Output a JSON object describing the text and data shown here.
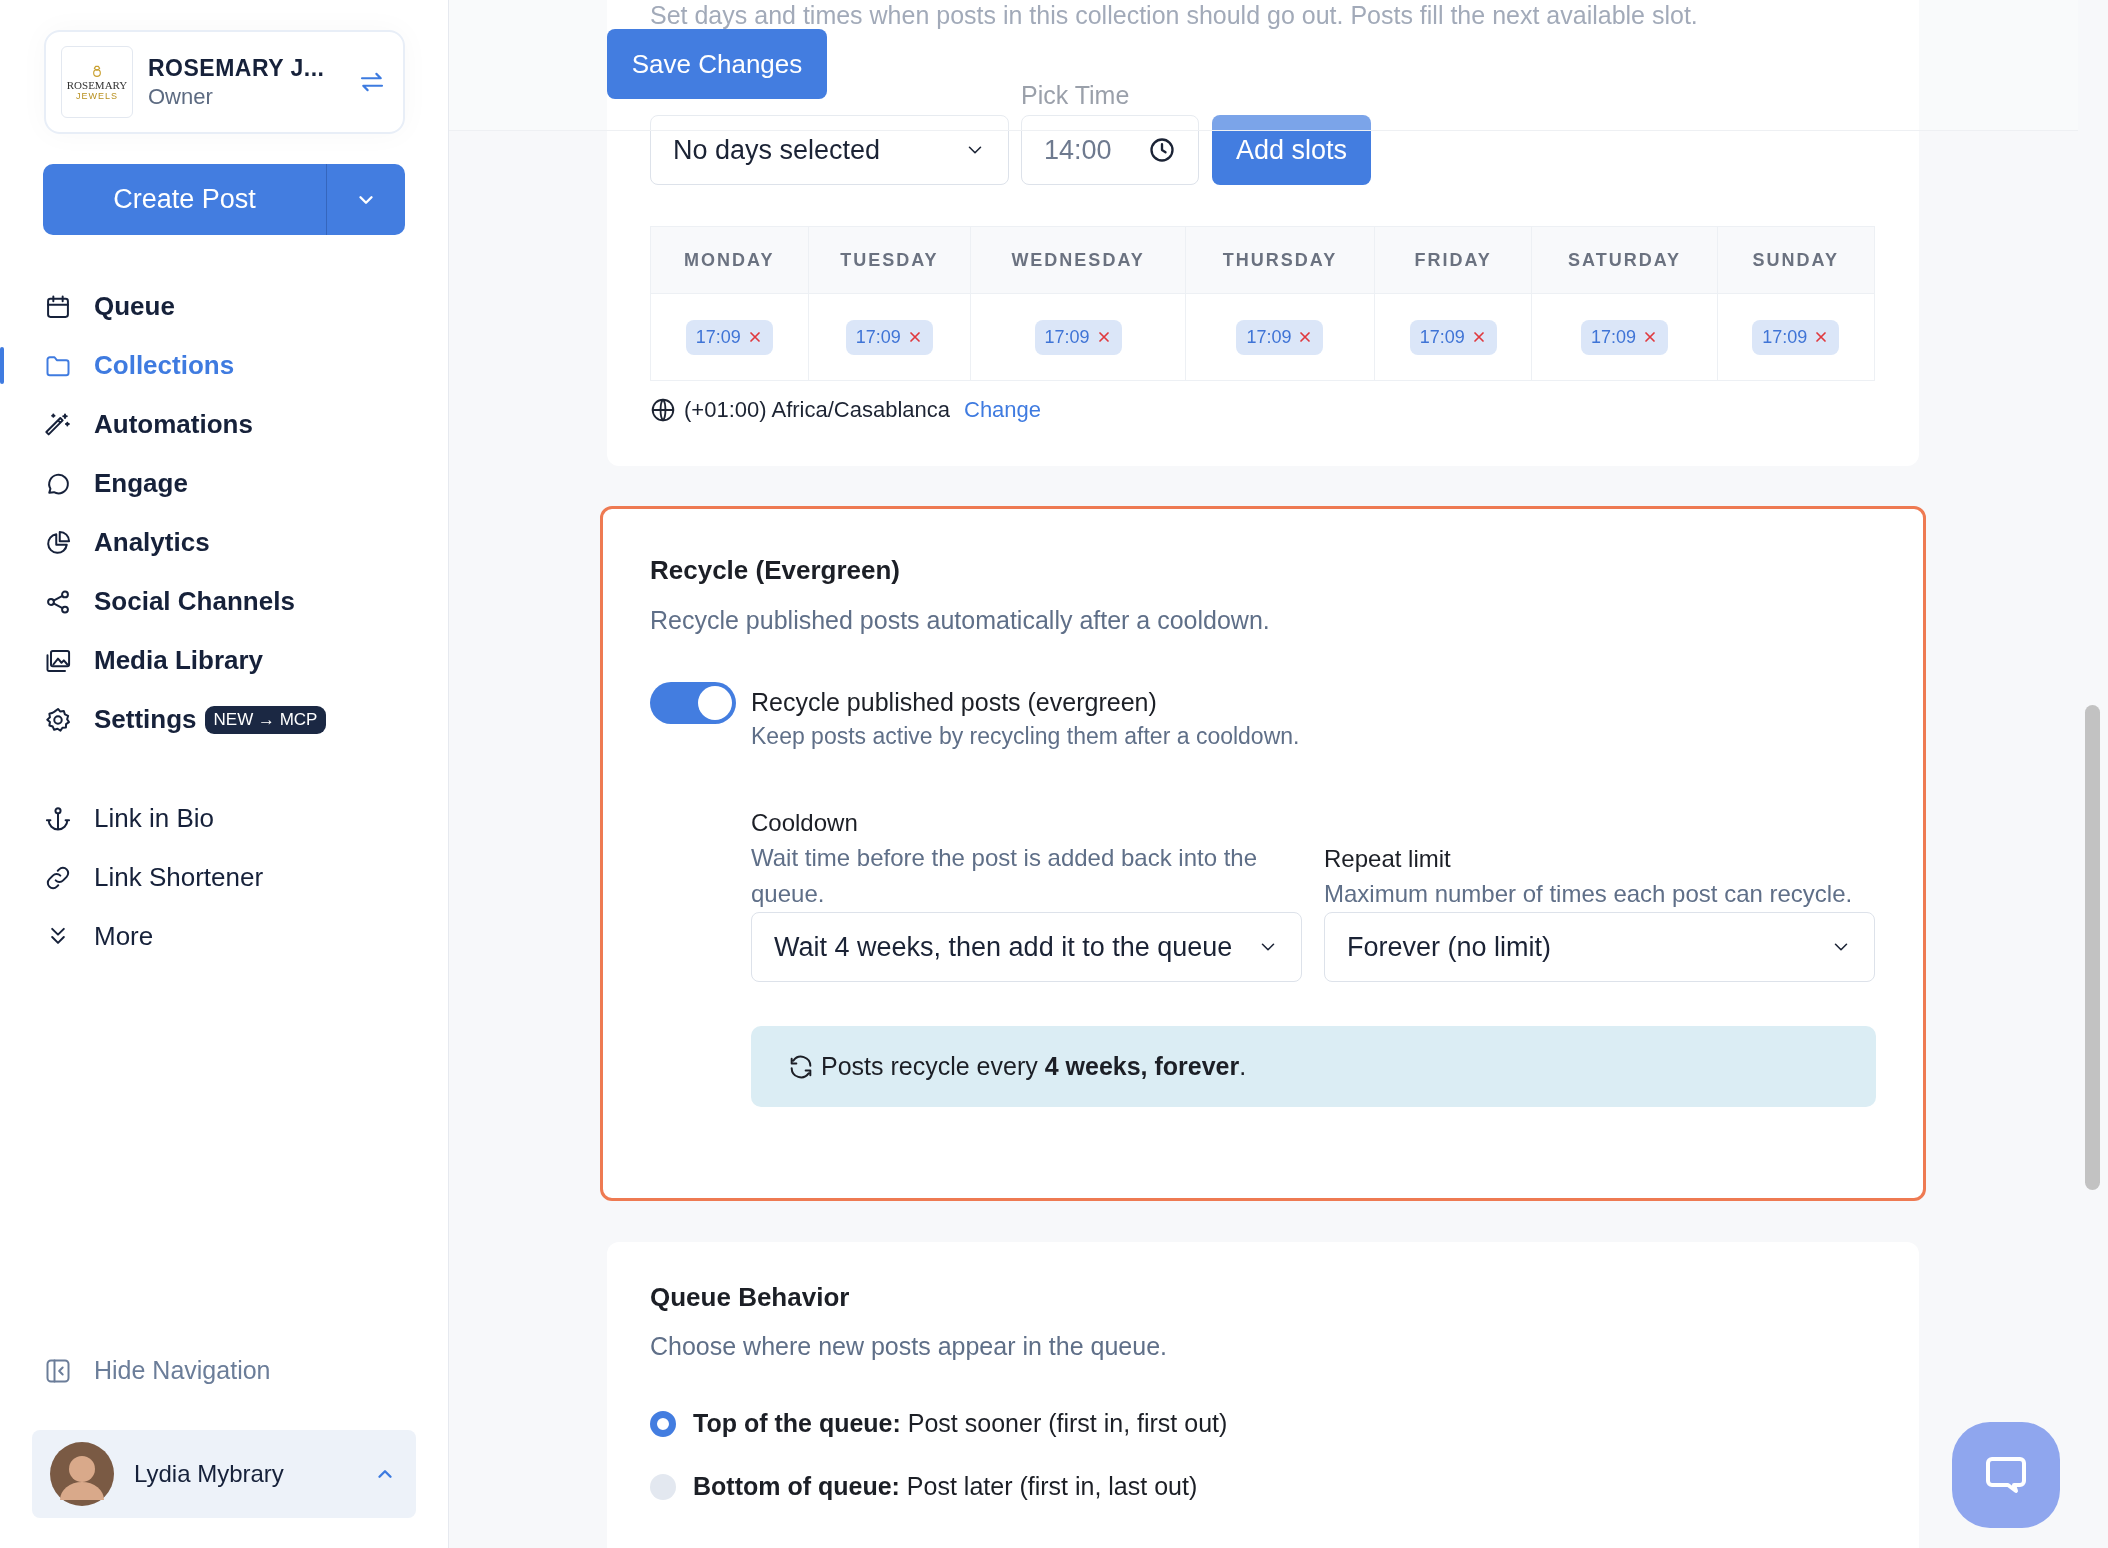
{
  "sidebar": {
    "account": {
      "logo_name": "ROSEMARY",
      "logo_tagline": "JEWELS",
      "name": "ROSEMARY J...",
      "role": "Owner"
    },
    "create_button": "Create Post",
    "primary_nav": [
      {
        "label": "Queue",
        "selected": false
      },
      {
        "label": "Collections",
        "selected": true
      },
      {
        "label": "Automations",
        "selected": false
      },
      {
        "label": "Engage",
        "selected": false
      },
      {
        "label": "Analytics",
        "selected": false
      },
      {
        "label": "Social Channels",
        "selected": false
      },
      {
        "label": "Media Library",
        "selected": false
      },
      {
        "label": "Settings",
        "selected": false,
        "badge": "NEW → MCP"
      }
    ],
    "secondary_nav": [
      {
        "label": "Link in Bio",
        "selected": false
      },
      {
        "label": "Link Shortener",
        "selected": false
      },
      {
        "label": "More",
        "selected": false
      }
    ],
    "hide_navigation": "Hide Navigation",
    "user": {
      "name": "Lydia Mybrary"
    }
  },
  "header": {
    "save_button": "Save Changes"
  },
  "schedule": {
    "description": "Set days and times when posts in this collection should go out. Posts fill the next available slot.",
    "days_value": "No days selected",
    "time_label": "Pick Time",
    "time_value": "14:00",
    "add_button": "Add slots",
    "table": {
      "columns": [
        {
          "day": "MONDAY",
          "slots": [
            "17:09"
          ]
        },
        {
          "day": "TUESDAY",
          "slots": [
            "17:09"
          ]
        },
        {
          "day": "WEDNESDAY",
          "slots": [
            "17:09"
          ]
        },
        {
          "day": "THURSDAY",
          "slots": [
            "17:09"
          ]
        },
        {
          "day": "FRIDAY",
          "slots": [
            "17:09"
          ]
        },
        {
          "day": "SATURDAY",
          "slots": [
            "17:09"
          ]
        },
        {
          "day": "SUNDAY",
          "slots": [
            "17:09"
          ]
        }
      ]
    },
    "timezone": "(+01:00) Africa/Casablanca",
    "change_link": "Change"
  },
  "recycle": {
    "highlighted": true,
    "title": "Recycle (Evergreen)",
    "description": "Recycle published posts automatically after a cooldown.",
    "toggle": {
      "label": "Recycle published posts (evergreen)",
      "hint": "Keep posts active by recycling them after a cooldown.",
      "on": true
    },
    "cooldown": {
      "label": "Cooldown",
      "hint": "Wait time before the post is added back into the queue.",
      "value": "Wait 4 weeks, then add it to the queue"
    },
    "repeat_limit": {
      "label": "Repeat limit",
      "hint": "Maximum number of times each post can recycle.",
      "value": "Forever (no limit)"
    },
    "summary": "Posts recycle every **4 weeks, forever**."
  },
  "queue_behavior": {
    "title": "Queue Behavior",
    "description": "Choose where new posts appear in the queue.",
    "options": [
      {
        "label": "**Top of the queue:** Post sooner (first in, first out)",
        "selected": true
      },
      {
        "label": "**Bottom of queue:** Post later (first in, last out)",
        "selected": false
      }
    ]
  }
}
